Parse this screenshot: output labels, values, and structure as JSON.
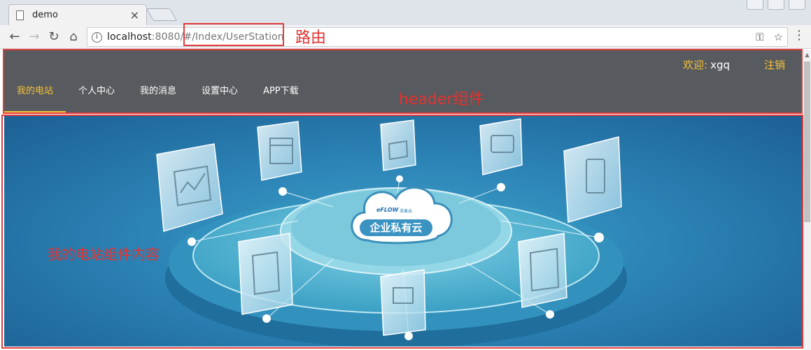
{
  "browser": {
    "tab_title": "demo",
    "url_host": "localhost",
    "url_rest": ":8080/#/Index/UserStation"
  },
  "header": {
    "welcome_label": "欢迎:",
    "username": "xgq",
    "logout_label": "注销",
    "nav_items": [
      "我的电站",
      "个人中心",
      "我的消息",
      "设置中心",
      "APP下载"
    ]
  },
  "banner": {
    "brand": "eFLOW",
    "brand_small": "流易云",
    "cloud_text": "企业私有云"
  },
  "annotations": {
    "route": "路由",
    "header_component": "header组件",
    "station_component": "我的电站组件内容"
  },
  "colors": {
    "accent": "#f5c23b",
    "header_bg": "#575a5e",
    "annotation_red": "#e2332f"
  }
}
